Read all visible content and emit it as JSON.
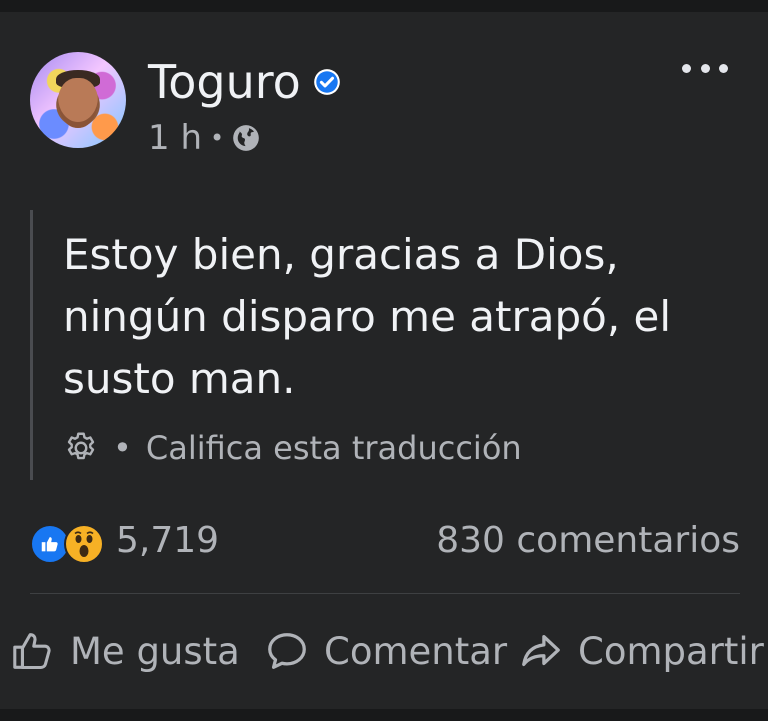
{
  "post": {
    "author": "Toguro",
    "time": "1 h",
    "meta_separator": "•",
    "privacy_icon": "globe-icon",
    "verified_icon": "verified-badge-icon",
    "more_icon": "more-options-icon"
  },
  "translation": {
    "text": "Estoy bien, gracias a Dios, ningún disparo me atrapó, el susto man.",
    "separator": "•",
    "rate_label": "Califica esta traducción",
    "icon": "gear-icon"
  },
  "stats": {
    "reactions": [
      "like",
      "wow"
    ],
    "reaction_count": "5,719",
    "comment_count": "830 comentarios"
  },
  "actions": {
    "like_label": "Me gusta",
    "comment_label": "Comentar",
    "share_label": "Compartir"
  },
  "colors": {
    "background": "#242526",
    "text_primary": "#e4e6eb",
    "text_secondary": "#b0b3b8",
    "accent_blue": "#1877f2",
    "wow_yellow": "#f7b125"
  }
}
